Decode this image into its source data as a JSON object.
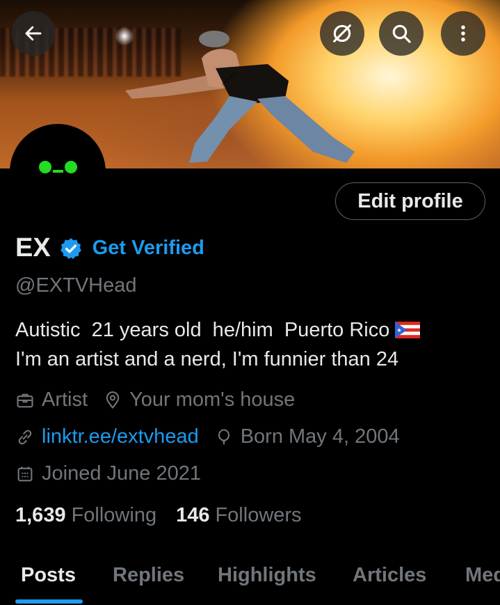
{
  "profile": {
    "name": "EX",
    "get_verified": "Get Verified",
    "handle": "@EXTVHead",
    "bio_line1": "Autistic  21 years old  he/him  Puerto Rico",
    "bio_line2": "I'm an artist and a nerd, I'm funnier than 24",
    "category": "Artist",
    "location": "Your mom's house",
    "website": "linktr.ee/extvhead",
    "birthday": "Born May 4, 2004",
    "joined": "Joined June 2021",
    "following_count": "1,639",
    "following_label": "Following",
    "followers_count": "146",
    "followers_label": "Followers"
  },
  "actions": {
    "edit_profile": "Edit profile"
  },
  "tabs": [
    {
      "label": "Posts",
      "active": true
    },
    {
      "label": "Replies",
      "active": false
    },
    {
      "label": "Highlights",
      "active": false
    },
    {
      "label": "Articles",
      "active": false
    },
    {
      "label": "Media",
      "active": false
    }
  ],
  "icons": {
    "back": "arrow-left-icon",
    "no_signal": "unsubscribe-icon",
    "search": "search-icon",
    "more": "more-vertical-icon",
    "verified": "verified-badge-icon",
    "category": "briefcase-icon",
    "location": "location-pin-icon",
    "link": "link-icon",
    "birthday": "balloon-icon",
    "joined": "calendar-icon"
  },
  "colors": {
    "accent": "#1d9bf0",
    "text_primary": "#e7e9ea",
    "text_secondary": "#71767b",
    "avatar_eyes": "#22dd22"
  }
}
